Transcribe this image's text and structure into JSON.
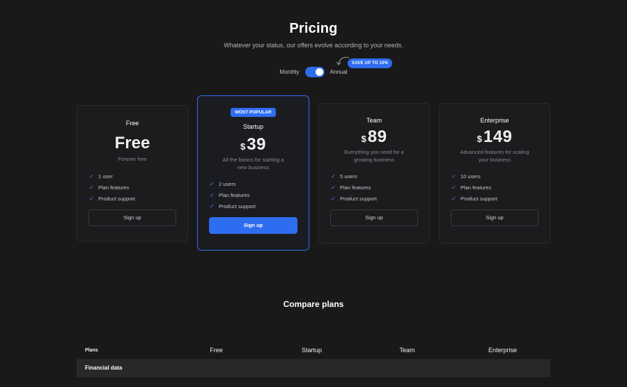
{
  "header": {
    "title": "Pricing",
    "subtitle": "Whatever your status, our offers evolve according to your needs."
  },
  "billing": {
    "monthly_label": "Monthly",
    "annual_label": "Annual",
    "save_badge": "SAVE UP TO 10%"
  },
  "plans": [
    {
      "name": "Free",
      "price": "Free",
      "note": "Forever free",
      "features": [
        "1 user",
        "Plan features",
        "Product support"
      ],
      "cta": "Sign up"
    },
    {
      "badge": "MOST POPULAR",
      "name": "Startup",
      "currency": "$",
      "price": "39",
      "note": "All the basics for starting a new business",
      "features": [
        "2 users",
        "Plan features",
        "Product support"
      ],
      "cta": "Sign up"
    },
    {
      "name": "Team",
      "currency": "$",
      "price": "89",
      "note": "Everything you need for a growing business",
      "features": [
        "5 users",
        "Plan features",
        "Product support"
      ],
      "cta": "Sign up"
    },
    {
      "name": "Enterprise",
      "currency": "$",
      "price": "149",
      "note": "Advanced features for scaling your business",
      "features": [
        "10 users",
        "Plan features",
        "Product support"
      ],
      "cta": "Sign up"
    }
  ],
  "compare": {
    "title": "Compare plans",
    "headers": [
      "Plans",
      "Free",
      "Startup",
      "Team",
      "Enterprise"
    ],
    "section": "Financial data"
  },
  "colors": {
    "background": "#19191a",
    "accent": "#2f6df0"
  }
}
